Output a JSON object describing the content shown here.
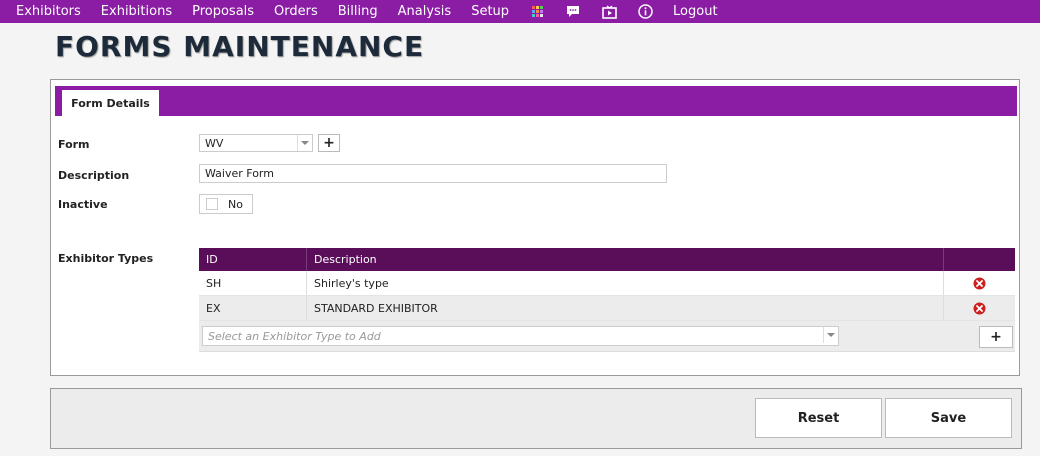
{
  "nav": {
    "items": [
      "Exhibitors",
      "Exhibitions",
      "Proposals",
      "Orders",
      "Billing",
      "Analysis",
      "Setup"
    ],
    "icons": [
      "grid-icon",
      "chat-icon",
      "media-icon",
      "info-icon"
    ],
    "logout": "Logout"
  },
  "page": {
    "title": "FORMS MAINTENANCE"
  },
  "tab": {
    "label": "Form Details"
  },
  "form": {
    "form_label": "Form",
    "form_value": "WV",
    "add_symbol": "+",
    "description_label": "Description",
    "description_value": "Waiver Form",
    "inactive_label": "Inactive",
    "inactive_value": "No",
    "exhibitor_types_label": "Exhibitor Types"
  },
  "grid": {
    "headers": {
      "id": "ID",
      "description": "Description"
    },
    "rows": [
      {
        "id": "SH",
        "description": "Shirley's type"
      },
      {
        "id": "EX",
        "description": "STANDARD EXHIBITOR"
      }
    ],
    "add_placeholder": "Select an Exhibitor Type to Add",
    "add_symbol": "+"
  },
  "footer": {
    "reset_label": "Reset",
    "save_label": "Save"
  },
  "colors": {
    "accent": "#8a1da3",
    "grid_header": "#5a0e5a",
    "delete": "#cc1f1f"
  }
}
